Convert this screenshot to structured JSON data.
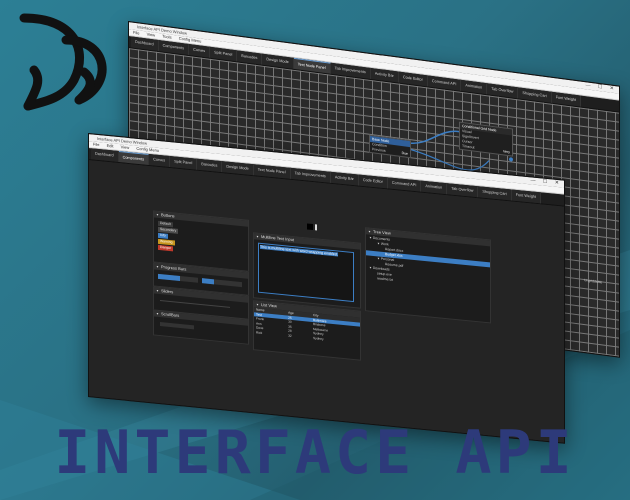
{
  "banner": "INTERFACE API",
  "colors": {
    "accent": "#3c7ec4",
    "banner": "#2d3a7a",
    "warn": "#c8961e",
    "danger": "#c0392b"
  },
  "back_window": {
    "title": "Interface API Demo Window",
    "menu": [
      "File",
      "View",
      "Tools",
      "Config Menu"
    ],
    "tabs": [
      "Dashboard",
      "Components",
      "Curves",
      "Split Panel",
      "Barcodes",
      "Design Mode",
      "Text Node Panel",
      "Tab Improvements",
      "Activity Bar",
      "Code Editor",
      "Command API",
      "Animation",
      "Tab Overflow",
      "Shopping Cart",
      "Font Weight"
    ],
    "active_tab": 6,
    "node_main": {
      "title": "Base Node",
      "rows": [
        "Condition",
        "Previous"
      ],
      "value": "Due"
    },
    "node_right": {
      "title": "Conditional Grid Node",
      "rows": [
        "Visual",
        "Sign/Invert",
        "Cursor",
        "Timeout"
      ],
      "value": "Very"
    },
    "bottom_labels": [
      "",
      "",
      "Ungriddable"
    ]
  },
  "front_window": {
    "title": "Interface API Demo Window",
    "menu": [
      "File",
      "Edit",
      "View",
      "Config Menu"
    ],
    "tabs": [
      "Dashboard",
      "Components",
      "Curves",
      "Split Panel",
      "Barcodes",
      "Design Mode",
      "Text Node Panel",
      "Tab Improvements",
      "Activity Bar",
      "Code Editor",
      "Command API",
      "Animation",
      "Tab Overflow",
      "Shopping Cart",
      "Font Weight"
    ],
    "active_tab": 1,
    "buttons_panel": {
      "title": "Buttons",
      "items": [
        "Default",
        "Secondary",
        "Info",
        "Warning",
        "Danger"
      ]
    },
    "progress_panel": {
      "title": "Progress Bars",
      "bar1": 0.55,
      "bar2": 0.3
    },
    "sliders_panel": {
      "title": "Sliders"
    },
    "scrollbars_panel": {
      "title": "ScrollBars"
    },
    "multiline": {
      "title": "Multiline Text Input",
      "text": "This is multiline text with word wrapping enabled."
    },
    "list_view": {
      "title": "List View",
      "headers": [
        "Name",
        "Age",
        "City"
      ],
      "rows": [
        [
          "Test",
          "25",
          "Baltimore"
        ],
        [
          "Frank",
          "30",
          "Brisbane"
        ],
        [
          "Ann",
          "35",
          "Melbourne"
        ],
        [
          "Dave",
          "28",
          "Sydney"
        ],
        [
          "Rick",
          "32",
          "Sydney"
        ]
      ],
      "selected": 0
    },
    "tree_view": {
      "title": "Tree View",
      "items": [
        {
          "label": "Documents",
          "depth": 0,
          "arrow": true
        },
        {
          "label": "Work",
          "depth": 1,
          "arrow": true
        },
        {
          "label": "Report.docx",
          "depth": 2
        },
        {
          "label": "Budget.xlsx",
          "depth": 2,
          "selected": true
        },
        {
          "label": "Personal",
          "depth": 1,
          "arrow": true
        },
        {
          "label": "Resume.pdf",
          "depth": 2
        },
        {
          "label": "Downloads",
          "depth": 0,
          "arrow": true
        },
        {
          "label": "setup.exe",
          "depth": 1
        },
        {
          "label": "readme.txt",
          "depth": 1
        }
      ]
    }
  }
}
